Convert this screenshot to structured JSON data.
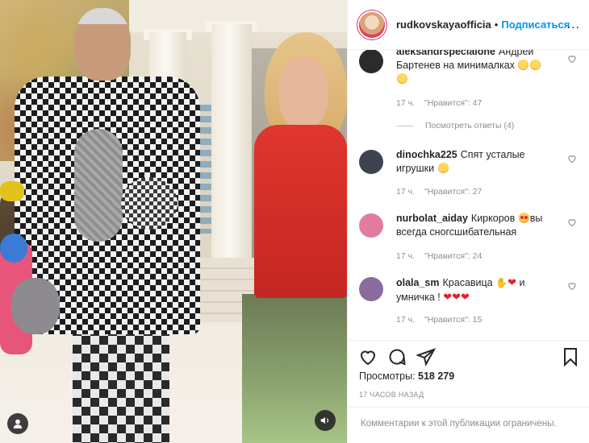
{
  "header": {
    "username": "rudkovskayaofficia",
    "separator": "•",
    "follow_label": "Подписаться",
    "more_label": "..."
  },
  "comments": [
    {
      "username": "aleksandrspecialone",
      "text": "Андрей Бартенев на минималках",
      "emoji": [
        "grinning-sweat",
        "grinning-sweat",
        "grinning-sweat"
      ],
      "time": "17 ч.",
      "likes": "\"Нравится\": 47",
      "replies": "Посмотреть ответы (4)",
      "avatar_color": "#2b2b2b"
    },
    {
      "username": "dinochka225",
      "text": "Спят усталые игрушки",
      "emoji": [
        "grinning-sweat"
      ],
      "time": "17 ч.",
      "likes": "\"Нравится\": 27",
      "avatar_color": "#3d4450"
    },
    {
      "username": "nurbolat_aiday",
      "text": "Киркоров",
      "text2": "вы всегда сногсшибательная",
      "emoji": [
        "heart-eyes"
      ],
      "time": "17 ч.",
      "likes": "\"Нравится\": 24",
      "avatar_color": "#e27ba0"
    },
    {
      "username": "olala_sm",
      "text": "Красавица",
      "text2": "и умничка !",
      "emoji": [
        "praying-hands",
        "red-heart",
        "red-heart",
        "red-heart",
        "red-heart"
      ],
      "time": "17 ч.",
      "likes": "\"Нравится\": 15",
      "avatar_color": "#8a6b9e"
    }
  ],
  "stats": {
    "views_label": "Просмотры:",
    "views_value": "518 279",
    "time_ago": "17 часов назад"
  },
  "footer": {
    "comments_closed": "Комментарии к этой публикации ограничены."
  },
  "colors": {
    "accent": "#0095f6",
    "text": "#262626",
    "muted": "#8e8e8e",
    "heart": "#e0242f"
  },
  "icons": {
    "like": "heart-outline-icon",
    "comment": "comment-bubble-icon",
    "share": "paper-plane-icon",
    "save": "bookmark-icon",
    "user_tag": "user-tag-icon",
    "sound": "speaker-icon"
  }
}
